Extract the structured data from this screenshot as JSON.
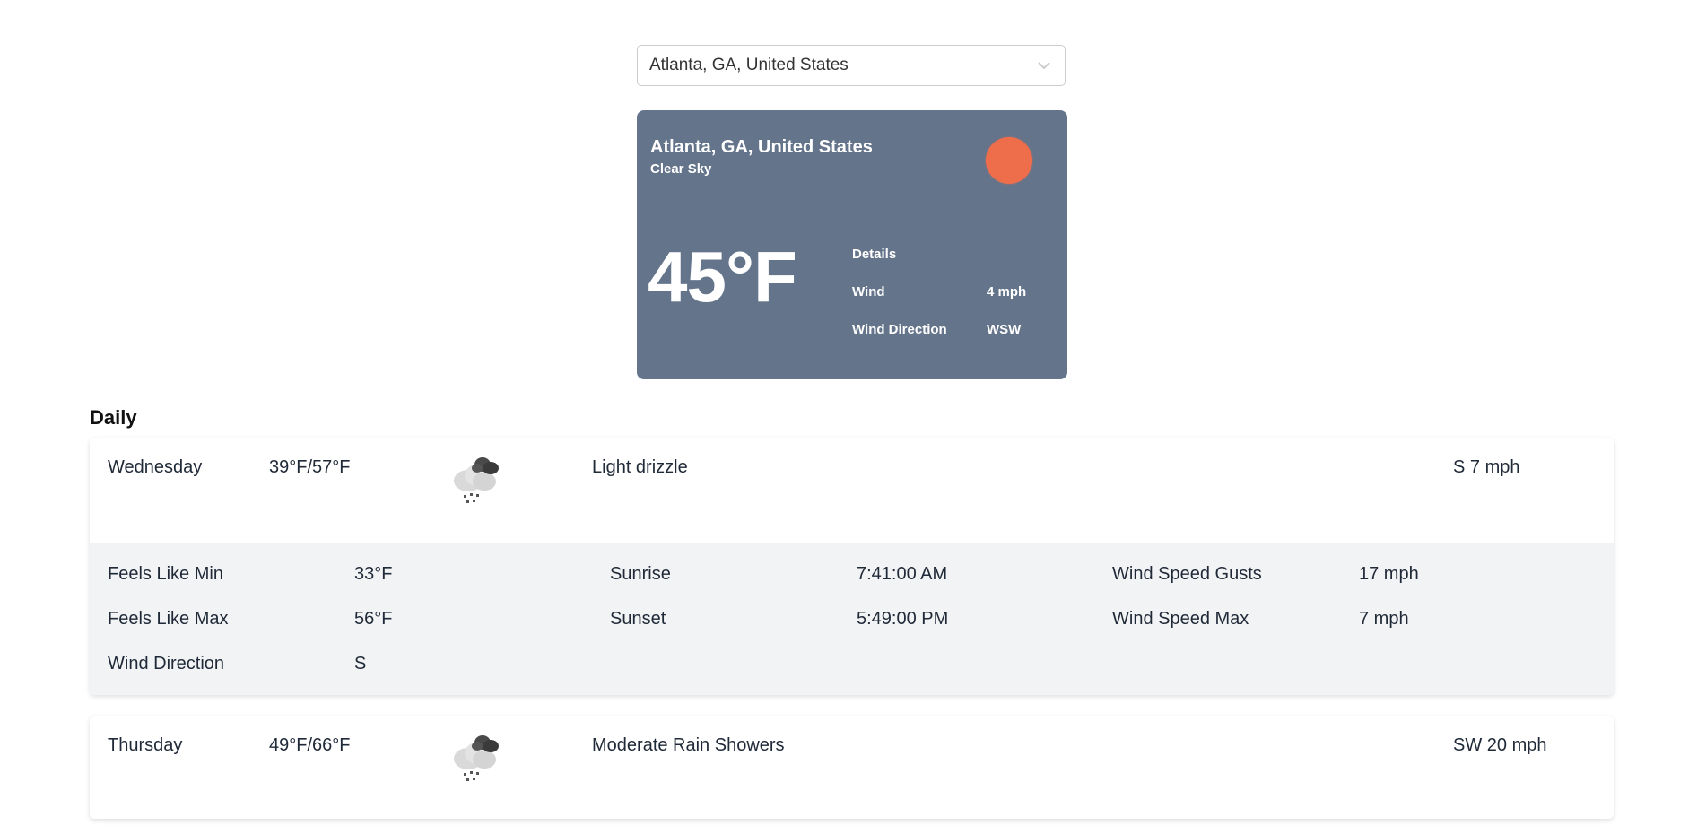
{
  "search": {
    "selected": "Atlanta, GA, United States"
  },
  "current": {
    "city": "Atlanta, GA, United States",
    "condition": "Clear Sky",
    "temperature": "45°F",
    "icon": "sun-icon",
    "details_title": "Details",
    "wind_label": "Wind",
    "wind_value": "4 mph",
    "wind_dir_label": "Wind Direction",
    "wind_dir_value": "WSW"
  },
  "daily": {
    "title": "Daily",
    "days": [
      {
        "day": "Wednesday",
        "temps": "39°F/57°F",
        "icon": "rain-cloud-icon",
        "description": "Light drizzle",
        "wind": "S 7 mph",
        "expanded": true,
        "details": {
          "feels_like_min_label": "Feels Like Min",
          "feels_like_min": "33°F",
          "feels_like_max_label": "Feels Like Max",
          "feels_like_max": "56°F",
          "wind_direction_label": "Wind Direction",
          "wind_direction": "S",
          "sunrise_label": "Sunrise",
          "sunrise": "7:41:00 AM",
          "sunset_label": "Sunset",
          "sunset": "5:49:00 PM",
          "gusts_label": "Wind Speed Gusts",
          "gusts": "17 mph",
          "max_label": "Wind Speed Max",
          "max": "7 mph"
        }
      },
      {
        "day": "Thursday",
        "temps": "49°F/66°F",
        "icon": "rain-cloud-icon",
        "description": "Moderate Rain Showers",
        "wind": "SW 20 mph",
        "expanded": false
      }
    ]
  },
  "colors": {
    "card_background": "#64748b",
    "sun": "#ee6e4c",
    "details_background": "#f2f3f5"
  }
}
